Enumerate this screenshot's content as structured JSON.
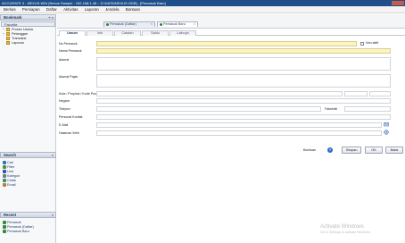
{
  "window": {
    "title": "ACCURATE 4 - NEXUS WIN [Nexus Sample : 192.168.1.46 :: D:\\DATA\\NEXUS.GDB] - [Pemasok Baru]"
  },
  "menubar": [
    "Berkas",
    "Persiapan",
    "Daftar",
    "Aktivitas",
    "Laporan",
    "Jendela",
    "Bantuan"
  ],
  "sidebar": {
    "bookmark_header": "Bookmark",
    "bookmark_ctrl": "+ ×",
    "favorites_header": "Favorite",
    "tree": [
      {
        "label": "Proses Usaha",
        "expander": "+"
      },
      {
        "label": "Pelanggan",
        "expander": "+"
      },
      {
        "label": "Transaksi",
        "expander": ""
      },
      {
        "label": "Laporan",
        "expander": ""
      }
    ],
    "search_header": "Search",
    "search_ctrl": "»",
    "search_links": [
      "Cari",
      "Filter",
      "Urut",
      "Kategori",
      "Cetak",
      "Email"
    ],
    "recent_header": "Recent",
    "recent_ctrl": "»",
    "recent_links": [
      "Pemasok",
      "Pemasok (Daftar)",
      "Pemasok Baru"
    ]
  },
  "tabs": [
    {
      "label": "Pemasok (Daftar)",
      "active": false
    },
    {
      "label": "Pemasok Baru",
      "active": true
    }
  ],
  "subtabs": [
    "Umum",
    "Info",
    "Catatan",
    "Saldo",
    "Lainnya"
  ],
  "form": {
    "fields": [
      {
        "label": "No Pemasok",
        "value": ""
      },
      {
        "label": "Nama Pemasok",
        "value": ""
      },
      {
        "label": "Alamat",
        "value": ""
      },
      {
        "label": "Alamat Pajak",
        "value": ""
      },
      {
        "label": "Kota / Propinsi / Kode Pos",
        "value": ""
      },
      {
        "label": "Negara",
        "value": ""
      },
      {
        "label": "Telepon",
        "value": ""
      },
      {
        "label": "Personal Kontak",
        "value": ""
      },
      {
        "label": "E-Mail",
        "value": ""
      },
      {
        "label": "Halaman Web",
        "value": ""
      }
    ],
    "checkbox_label": "Non aktif",
    "fax_label": "Faksimili"
  },
  "buttons": {
    "help": "Bantuan",
    "save": "Simpan",
    "ok": "OK",
    "cancel": "Batal"
  },
  "watermark": {
    "line1": "Activate Windows",
    "line2": "Go to Settings to activate Windows."
  },
  "colors": {
    "titlebar": "#1e4f8a",
    "required_field": "#fbf5c4"
  }
}
